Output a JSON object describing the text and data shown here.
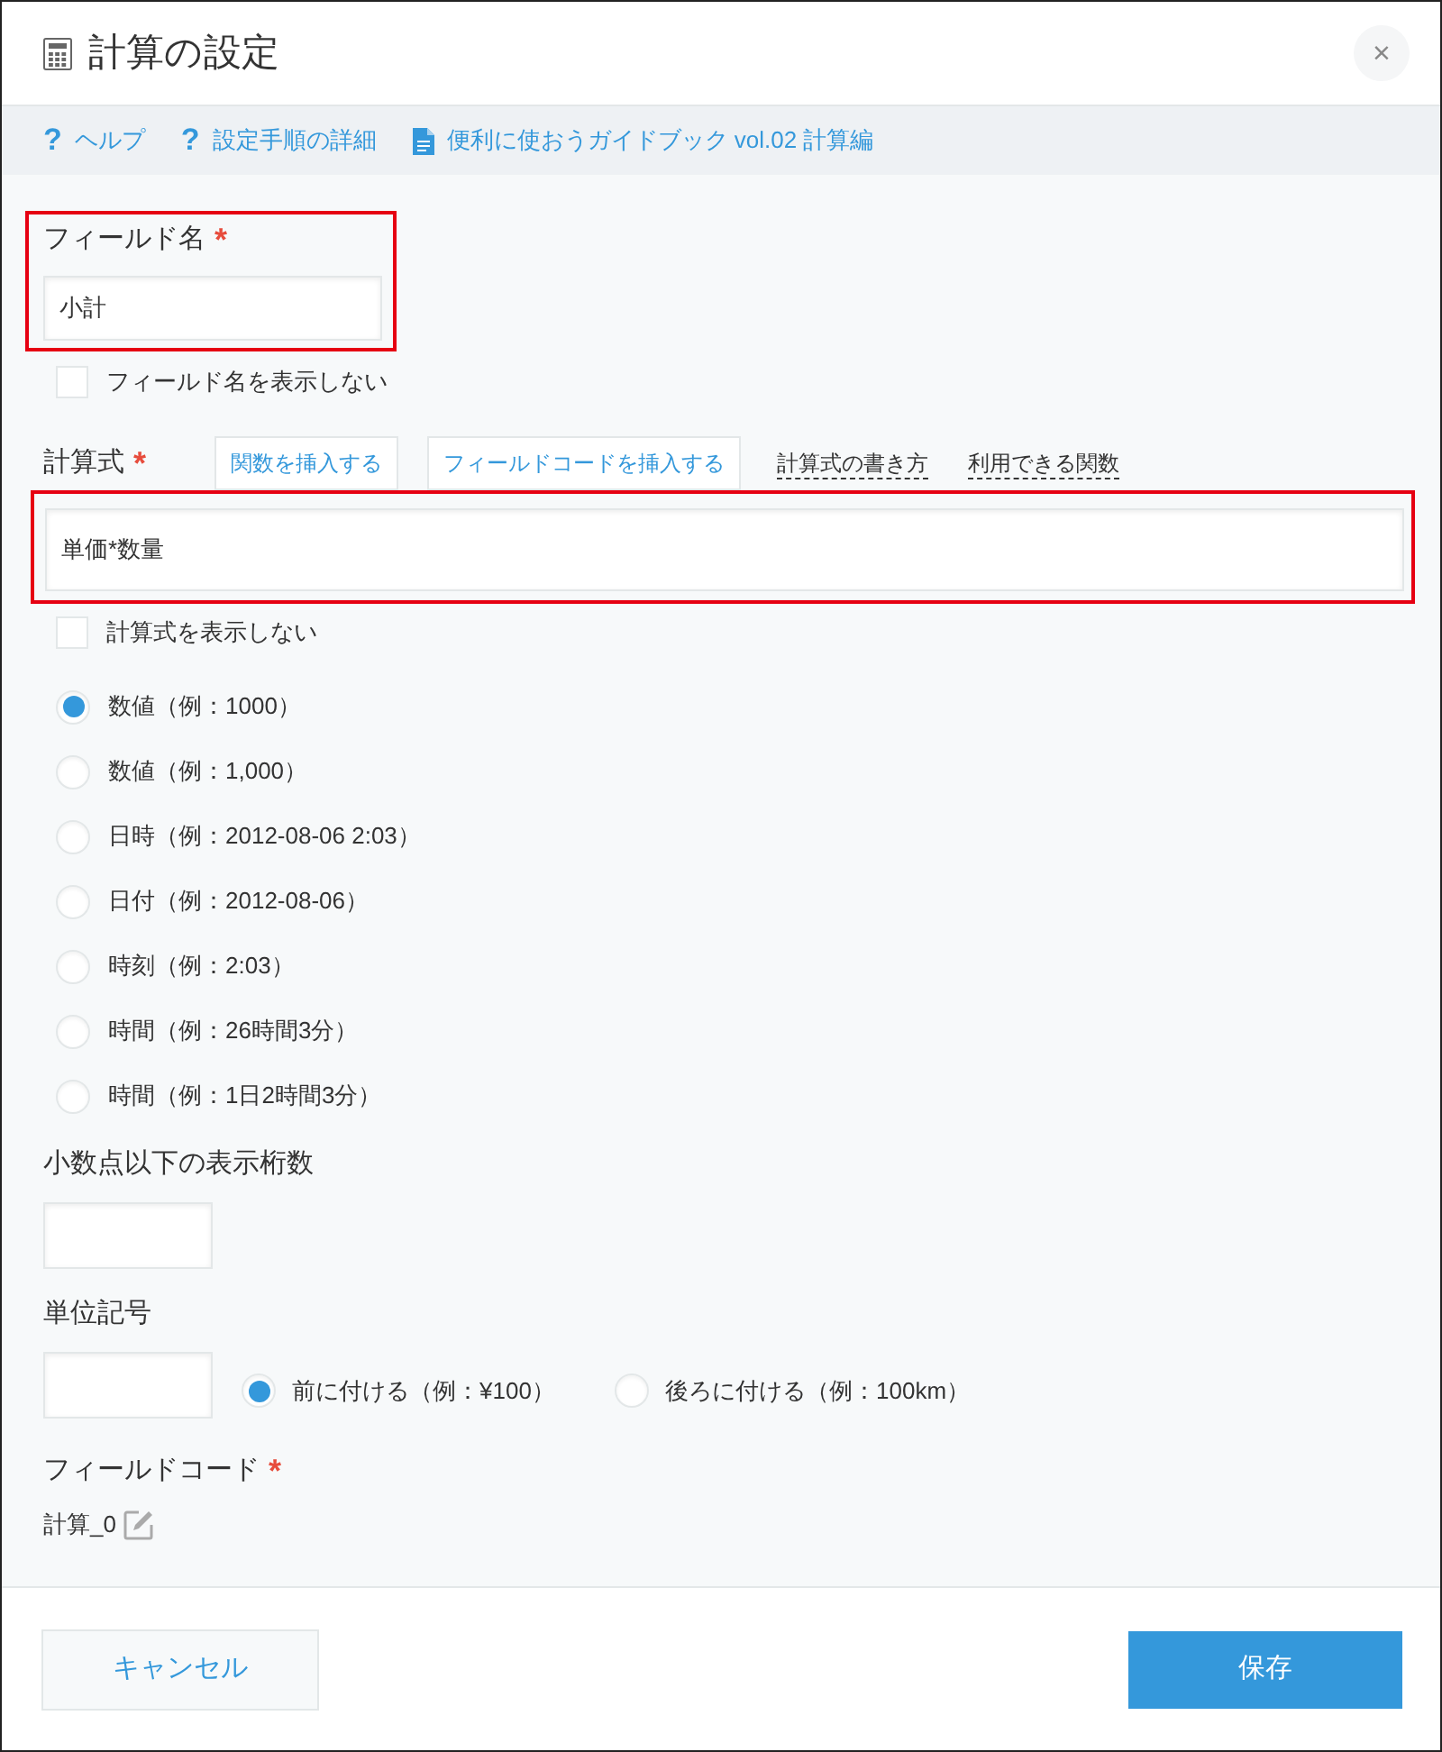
{
  "dialog": {
    "title": "計算の設定",
    "close_mark": "×"
  },
  "help_links": [
    {
      "kind": "help",
      "mark": "?",
      "label": "ヘルプ"
    },
    {
      "kind": "help",
      "mark": "?",
      "label": "設定手順の詳細"
    },
    {
      "kind": "document",
      "label": "便利に使おうガイドブック vol.02 計算編"
    }
  ],
  "field_name": {
    "label": "フィールド名",
    "required_mark": "*",
    "value": "小計",
    "highlighted": true
  },
  "hide_field_name": {
    "label": "フィールド名を表示しない",
    "checked": false
  },
  "formula": {
    "label": "計算式",
    "required_mark": "*",
    "buttons": [
      "関数を挿入する",
      "フィールドコードを挿入する"
    ],
    "links": [
      "計算式の書き方",
      "利用できる関数"
    ],
    "value": "単価*数量",
    "highlighted": true
  },
  "hide_formula": {
    "label": "計算式を表示しない",
    "checked": false
  },
  "display_formats": [
    {
      "label": "数値（例：1000）",
      "selected": true
    },
    {
      "label": "数値（例：1,000）",
      "selected": false
    },
    {
      "label": "日時（例：2012-08-06 2:03）",
      "selected": false
    },
    {
      "label": "日付（例：2012-08-06）",
      "selected": false
    },
    {
      "label": "時刻（例：2:03）",
      "selected": false
    },
    {
      "label": "時間（例：26時間3分）",
      "selected": false
    },
    {
      "label": "時間（例：1日2時間3分）",
      "selected": false
    }
  ],
  "decimal_places": {
    "label": "小数点以下の表示桁数"
  },
  "unit": {
    "label": "単位記号",
    "positions": [
      {
        "label": "前に付ける（例：¥100）",
        "selected": true
      },
      {
        "label": "後ろに付ける（例：100km）",
        "selected": false
      }
    ]
  },
  "field_code": {
    "label": "フィールドコード",
    "required_mark": "*",
    "value": "計算_0"
  },
  "footer": {
    "buttons": [
      {
        "kind": "secondary",
        "label": "キャンセル"
      },
      {
        "kind": "primary",
        "label": "保存"
      }
    ]
  }
}
